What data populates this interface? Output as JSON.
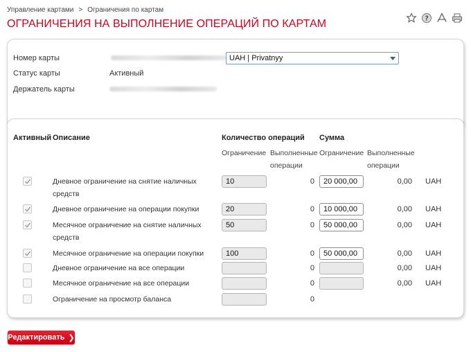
{
  "breadcrumb": {
    "items": [
      "Управление картами",
      "Ограничения по картам"
    ],
    "separator": ">"
  },
  "page_title": "ОГРАНИЧЕНИЯ НА ВЫПОЛНЕНИЕ ОПЕРАЦИЙ ПО КАРТАМ",
  "toolbar_icons": [
    "star-icon",
    "help-icon",
    "pdf-icon",
    "print-icon"
  ],
  "card_info": {
    "card_number_label": "Номер карты",
    "card_select_value": "UAH | Privatnyy",
    "status_label": "Статус карты",
    "status_value": "Активный",
    "holder_label": "Держатель карты"
  },
  "table": {
    "headers": {
      "active": "Активный",
      "description": "Описание",
      "ops_count": "Количество операций",
      "sum": "Сумма",
      "limit": "Ограничение",
      "done_line1": "Выполненные",
      "done_line2": "операции"
    },
    "rows": [
      {
        "checked": true,
        "desc1": "Дневное ограничение на снятие наличных",
        "desc2": "средств",
        "limit": "10",
        "done": "0",
        "sum": "20 000,00",
        "sum_done": "0,00",
        "currency": "UAH"
      },
      {
        "checked": true,
        "desc1": "Дневное ограничение на операции покупки",
        "desc2": "",
        "limit": "20",
        "done": "0",
        "sum": "10 000,00",
        "sum_done": "0,00",
        "currency": "UAH"
      },
      {
        "checked": true,
        "desc1": "Месячное ограничение на снятие наличных",
        "desc2": "средств",
        "limit": "50",
        "done": "0",
        "sum": "50 000,00",
        "sum_done": "0,00",
        "currency": "UAH"
      },
      {
        "checked": true,
        "desc1": "Месячное ограничение на операции покупки",
        "desc2": "",
        "limit": "100",
        "done": "0",
        "sum": "50 000,00",
        "sum_done": "0,00",
        "currency": "UAH"
      },
      {
        "checked": false,
        "desc1": "Дневное ограничение на все операции",
        "desc2": "",
        "limit": "",
        "done": "0",
        "sum": "",
        "sum_done": "0,00",
        "currency": "UAH"
      },
      {
        "checked": false,
        "desc1": "Месячное ограничение на все операции",
        "desc2": "",
        "limit": "",
        "done": "0",
        "sum": "",
        "sum_done": "0,00",
        "currency": "UAH"
      },
      {
        "checked": false,
        "desc1": "Ограничение на просмотр баланса",
        "desc2": "",
        "limit": "",
        "done": "0"
      }
    ]
  },
  "edit_button_label": "Редактировать",
  "colors": {
    "accent": "#d8001b",
    "button": "#e0101f"
  }
}
